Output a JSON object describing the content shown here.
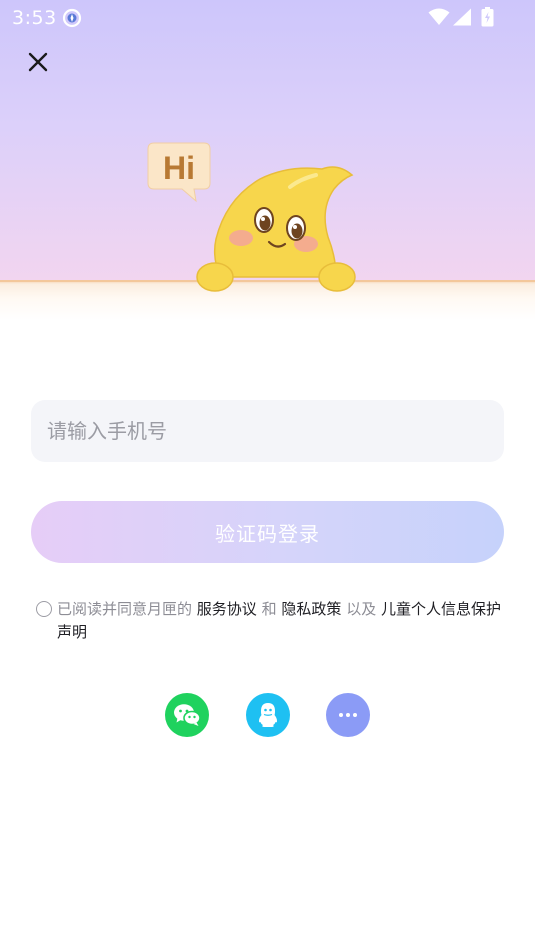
{
  "status_bar": {
    "time": "3:53"
  },
  "icons": {
    "close": "close-icon",
    "wechat": "wechat-icon",
    "qq": "qq-icon",
    "more": "more-icon",
    "mascot": "moon-mascot-illustration"
  },
  "mascot": {
    "bubble_text": "Hi"
  },
  "login": {
    "phone_placeholder": "请输入手机号",
    "phone_value": "",
    "submit_label": "验证码登录"
  },
  "agreement": {
    "checked": false,
    "prefix": "已阅读并同意月匣的",
    "service_link": "服务协议",
    "joiner_and": "和",
    "privacy_link": "隐私政策",
    "joiner_also": "以及",
    "child_link": "儿童个人信息保护声明"
  },
  "colors": {
    "wechat": "#1fd25e",
    "qq": "#1ec0f2",
    "more": "#8b9bf6",
    "button_gradient_start": "#e6cdf7",
    "button_gradient_end": "#c6d2fb"
  }
}
